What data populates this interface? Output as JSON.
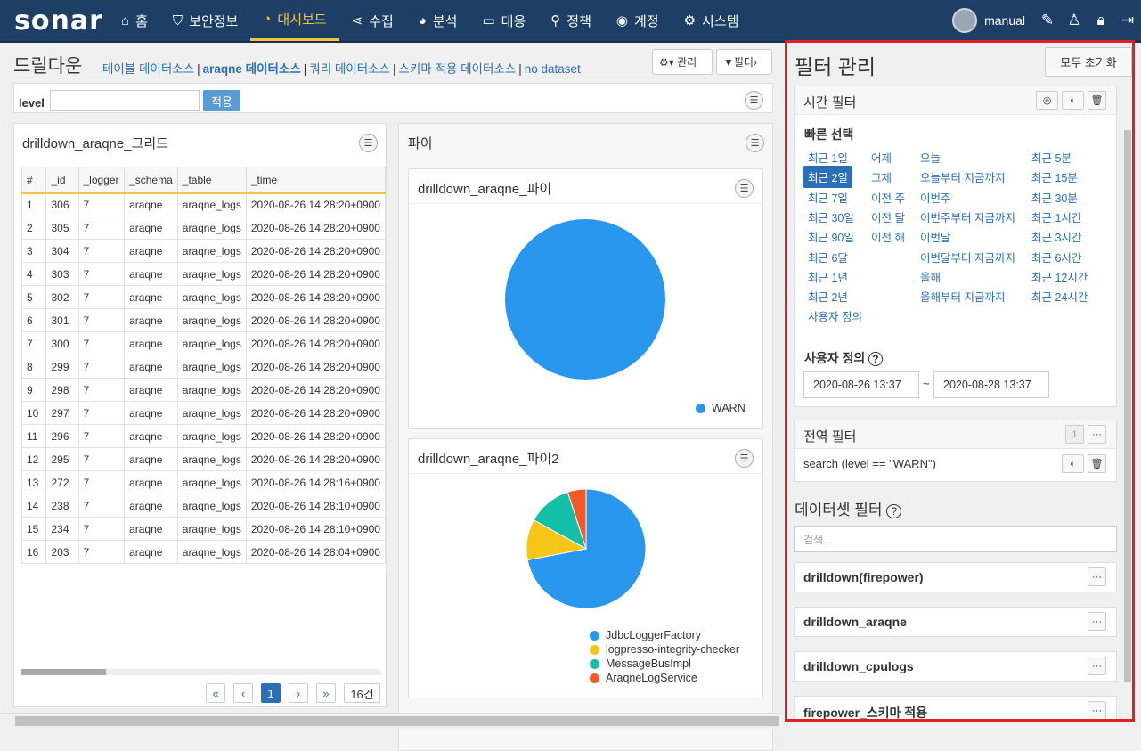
{
  "header": {
    "logo": "sonar",
    "nav": [
      {
        "icon": "home-icon",
        "glyph": "⌂",
        "label": "홈"
      },
      {
        "icon": "shield-icon",
        "glyph": "⛉",
        "label": "보안정보"
      },
      {
        "icon": "dashboard-icon",
        "glyph": "◔",
        "label": "대시보드",
        "active": true
      },
      {
        "icon": "share-icon",
        "glyph": "⋖",
        "label": "수집"
      },
      {
        "icon": "pie-chart-icon",
        "glyph": "◕",
        "label": "분석"
      },
      {
        "icon": "monitor-icon",
        "glyph": "▭",
        "label": "대응"
      },
      {
        "icon": "search-icon",
        "glyph": "⚲",
        "label": "정책"
      },
      {
        "icon": "user-circle-icon",
        "glyph": "◉",
        "label": "계정"
      },
      {
        "icon": "gear-icon",
        "glyph": "⚙",
        "label": "시스템"
      }
    ],
    "username": "manual"
  },
  "page": {
    "title": "드릴다운",
    "datasources": [
      "테이블 데이터소스",
      "araqne 데이터소스",
      "쿼리 데이터소스",
      "스키마 적용 데이터소스",
      "no dataset"
    ],
    "manage_label": "관리",
    "filter_label": "필터",
    "level_label": "level",
    "level_value": "",
    "apply_label": "적용"
  },
  "grid": {
    "title": "drilldown_araqne_그리드",
    "columns": [
      "#",
      "_id",
      "_logger",
      "_schema",
      "_table",
      "_time"
    ],
    "rows": [
      [
        "1",
        "306",
        "7",
        "araqne",
        "araqne_logs",
        "2020-08-26 14:28:20+0900"
      ],
      [
        "2",
        "305",
        "7",
        "araqne",
        "araqne_logs",
        "2020-08-26 14:28:20+0900"
      ],
      [
        "3",
        "304",
        "7",
        "araqne",
        "araqne_logs",
        "2020-08-26 14:28:20+0900"
      ],
      [
        "4",
        "303",
        "7",
        "araqne",
        "araqne_logs",
        "2020-08-26 14:28:20+0900"
      ],
      [
        "5",
        "302",
        "7",
        "araqne",
        "araqne_logs",
        "2020-08-26 14:28:20+0900"
      ],
      [
        "6",
        "301",
        "7",
        "araqne",
        "araqne_logs",
        "2020-08-26 14:28:20+0900"
      ],
      [
        "7",
        "300",
        "7",
        "araqne",
        "araqne_logs",
        "2020-08-26 14:28:20+0900"
      ],
      [
        "8",
        "299",
        "7",
        "araqne",
        "araqne_logs",
        "2020-08-26 14:28:20+0900"
      ],
      [
        "9",
        "298",
        "7",
        "araqne",
        "araqne_logs",
        "2020-08-26 14:28:20+0900"
      ],
      [
        "10",
        "297",
        "7",
        "araqne",
        "araqne_logs",
        "2020-08-26 14:28:20+0900"
      ],
      [
        "11",
        "296",
        "7",
        "araqne",
        "araqne_logs",
        "2020-08-26 14:28:20+0900"
      ],
      [
        "12",
        "295",
        "7",
        "araqne",
        "araqne_logs",
        "2020-08-26 14:28:20+0900"
      ],
      [
        "13",
        "272",
        "7",
        "araqne",
        "araqne_logs",
        "2020-08-26 14:28:16+0900"
      ],
      [
        "14",
        "238",
        "7",
        "araqne",
        "araqne_logs",
        "2020-08-26 14:28:10+0900"
      ],
      [
        "15",
        "234",
        "7",
        "araqne",
        "araqne_logs",
        "2020-08-26 14:28:10+0900"
      ],
      [
        "16",
        "203",
        "7",
        "araqne",
        "araqne_logs",
        "2020-08-26 14:28:04+0900"
      ]
    ],
    "pager": {
      "first": "«",
      "prev": "‹",
      "current": "1",
      "next": "›",
      "last": "»",
      "total": "16건"
    }
  },
  "pie_panel": {
    "title": "파이",
    "pie1_title": "drilldown_araqne_파이",
    "pie2_title": "drilldown_araqne_파이2"
  },
  "chart_data": [
    {
      "type": "pie",
      "categories": [
        "WARN"
      ],
      "values": [
        1
      ],
      "colors": [
        "#2a97ee"
      ]
    },
    {
      "type": "pie",
      "categories": [
        "JdbcLoggerFactory",
        "logpresso-integrity-checker",
        "MessageBusImpl",
        "AraqneLogService"
      ],
      "values": [
        0.72,
        0.11,
        0.12,
        0.05
      ],
      "colors": [
        "#2a97ee",
        "#f5c518",
        "#13bfa6",
        "#f45a28"
      ]
    }
  ],
  "filter_panel": {
    "title": "필터 관리",
    "reset_label": "모두 초기화",
    "time_filter": {
      "title": "시간 필터",
      "quick_label": "빠른 선택",
      "col1": [
        "최근 1일",
        "최근 2일",
        "최근 7일",
        "최근 30일",
        "최근 90일",
        "최근 6달",
        "최근 1년",
        "최근 2년",
        "사용자 정의"
      ],
      "col2": [
        "어제",
        "그제",
        "이전 주",
        "이전 달",
        "이전 해"
      ],
      "col3": [
        "오늘",
        "오늘부터 지금까지",
        "이번주",
        "이번주부터 지금까지",
        "이번달",
        "이번달부터 지금까지",
        "올해",
        "올해부터 지금까지"
      ],
      "col4": [
        "최근 5분",
        "최근 15분",
        "최근 30분",
        "최근 1시간",
        "최근 3시간",
        "최근 6시간",
        "최근 12시간",
        "최근 24시간"
      ],
      "custom_label": "사용자 정의",
      "from": "2020-08-26 13:37",
      "tilde": "~",
      "to": "2020-08-28 13:37"
    },
    "global_filter": {
      "title": "전역 필터",
      "count": "1",
      "expression": "search (level == \"WARN\")"
    },
    "dataset_filter": {
      "title": "데이터셋 필터",
      "search_placeholder": "검색...",
      "datasets": [
        "drilldown(firepower)",
        "drilldown_araqne",
        "drilldown_cpulogs",
        "firepower_스키마 적용"
      ]
    }
  }
}
